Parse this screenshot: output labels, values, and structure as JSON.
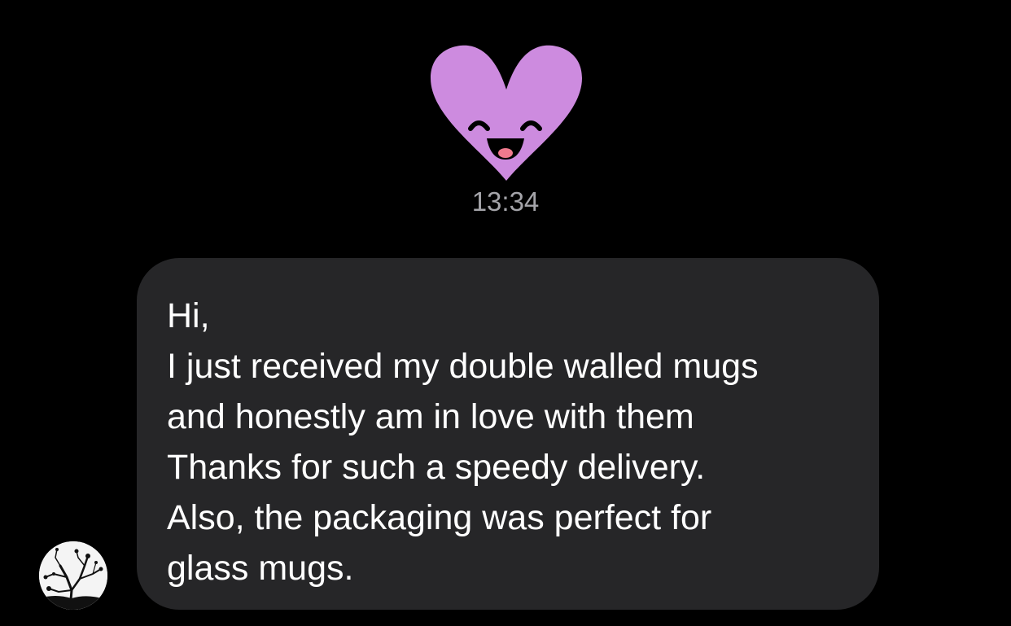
{
  "colors": {
    "background": "#000000",
    "bubble": "#262628",
    "heart": "#cd8bdf",
    "timestamp": "#a4a4a9",
    "message_text": "#ffffff"
  },
  "sticker": {
    "icon": "smiling-purple-heart-sticker"
  },
  "timestamp": "13:34",
  "message": {
    "lines": [
      "Hi,",
      "I just received my double walled mugs",
      "and honestly am in love with them",
      "Thanks for such a speedy delivery.",
      "Also, the packaging was perfect for",
      "glass mugs."
    ]
  },
  "sender": {
    "avatar_icon": "tree-silhouette-avatar"
  }
}
